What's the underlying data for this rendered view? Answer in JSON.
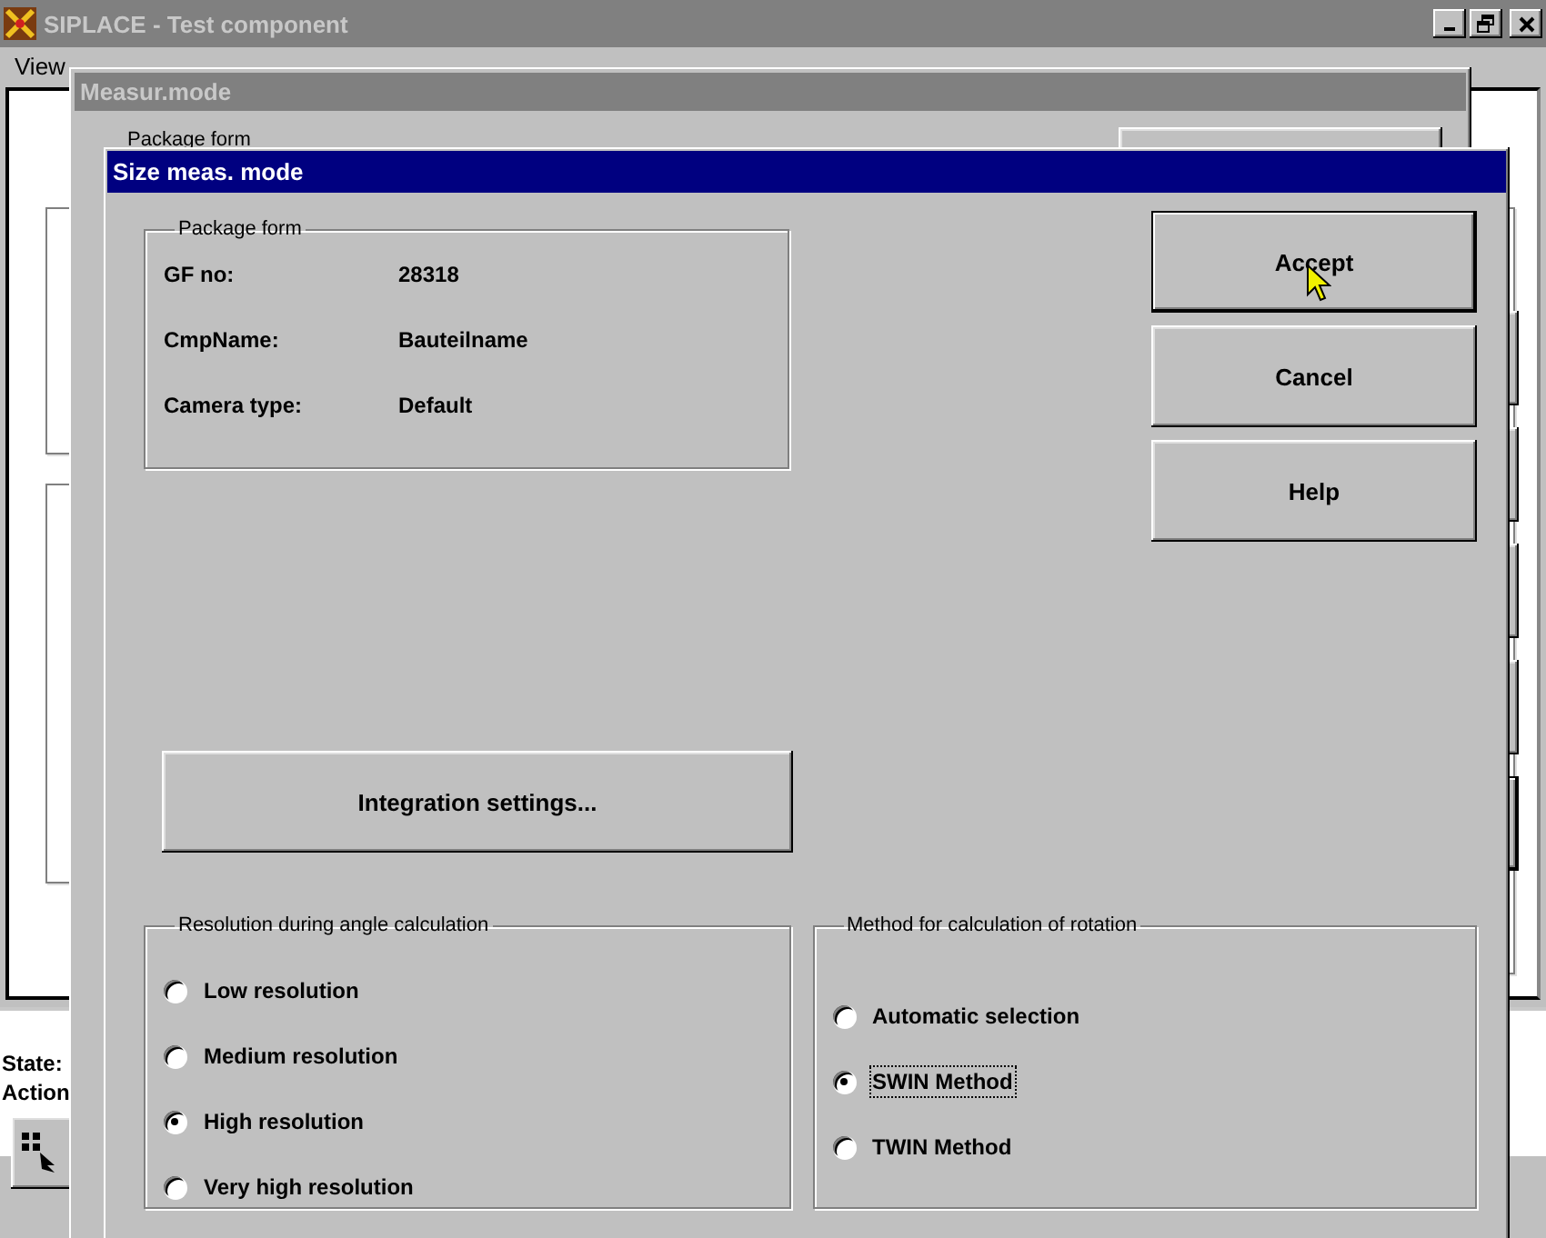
{
  "main_window": {
    "title": "SIPLACE - Test component",
    "menu": [
      {
        "label": "View"
      }
    ],
    "status": [
      {
        "label": "State:"
      },
      {
        "label": "Action"
      }
    ]
  },
  "back_dialog": {
    "title": "Measur.mode",
    "group_label": "Package form"
  },
  "dialog": {
    "title": "Size meas. mode",
    "package_form": {
      "title": "Package form",
      "fields": [
        {
          "label": "GF no:",
          "value": "28318"
        },
        {
          "label": "CmpName:",
          "value": "Bauteilname"
        },
        {
          "label": "Camera type:",
          "value": "Default"
        }
      ]
    },
    "buttons": [
      {
        "label": "Accept",
        "default": true
      },
      {
        "label": "Cancel",
        "default": false
      },
      {
        "label": "Help",
        "default": false
      }
    ],
    "integration_button": "Integration settings...",
    "resolution": {
      "title": "Resolution during angle calculation",
      "options": [
        {
          "label": "Low resolution",
          "selected": false,
          "focused": false
        },
        {
          "label": "Medium resolution",
          "selected": false,
          "focused": false
        },
        {
          "label": "High resolution",
          "selected": true,
          "focused": false
        },
        {
          "label": "Very high resolution",
          "selected": false,
          "focused": false
        }
      ]
    },
    "method": {
      "title": "Method for calculation of rotation",
      "options": [
        {
          "label": "Automatic selection",
          "selected": false,
          "focused": false
        },
        {
          "label": "SWIN Method",
          "selected": true,
          "focused": true
        },
        {
          "label": "TWIN Method",
          "selected": false,
          "focused": false
        }
      ]
    }
  }
}
